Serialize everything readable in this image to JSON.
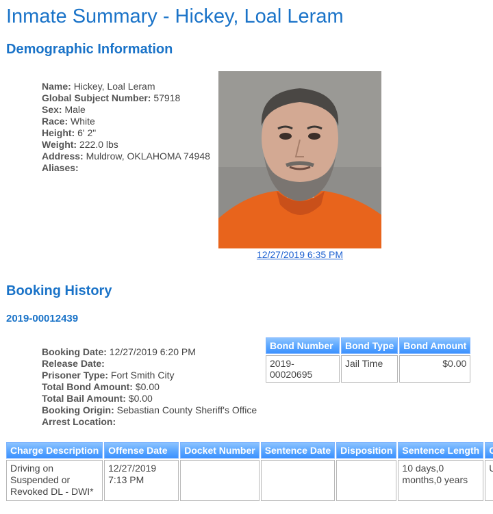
{
  "page": {
    "title": "Inmate Summary - Hickey, Loal Leram"
  },
  "demographic": {
    "heading": "Demographic Information",
    "fields": [
      {
        "label": "Name:",
        "value": "Hickey, Loal Leram"
      },
      {
        "label": "Global Subject Number:",
        "value": "57918"
      },
      {
        "label": "Sex:",
        "value": "Male"
      },
      {
        "label": "Race:",
        "value": "White"
      },
      {
        "label": "Height:",
        "value": "6' 2\""
      },
      {
        "label": "Weight:",
        "value": "222.0 lbs"
      },
      {
        "label": "Address:",
        "value": "Muldrow, OKLAHOMA 74948"
      },
      {
        "label": "Aliases:",
        "value": ""
      }
    ],
    "photo_date": "12/27/2019 6:35 PM"
  },
  "booking": {
    "heading": "Booking History",
    "number": "2019-00012439",
    "fields": [
      {
        "label": "Booking Date:",
        "value": "12/27/2019 6:20 PM"
      },
      {
        "label": "Release Date:",
        "value": ""
      },
      {
        "label": "Prisoner Type:",
        "value": "Fort Smith City"
      },
      {
        "label": "Total Bond Amount:",
        "value": "$0.00"
      },
      {
        "label": "Total Bail Amount:",
        "value": "$0.00"
      },
      {
        "label": "Booking Origin:",
        "value": "Sebastian County Sheriff's Office"
      },
      {
        "label": "Arrest Location:",
        "value": ""
      }
    ],
    "bond_table": {
      "headers": [
        "Bond Number",
        "Bond Type",
        "Bond Amount"
      ],
      "rows": [
        [
          "2019-00020695",
          "Jail Time",
          "$0.00"
        ]
      ]
    },
    "charge_table": {
      "headers": [
        "Charge Description",
        "Offense Date",
        "Docket Number",
        "Sentence Date",
        "Disposition",
        "Sentence Length",
        "C"
      ],
      "rows": [
        [
          "Driving on Suspended or Revoked DL - DWI*",
          "12/27/2019 7:13 PM",
          "",
          "",
          "",
          "10 days,0 months,0 years",
          "U"
        ]
      ]
    }
  },
  "colors": {
    "heading": "#1a73c8",
    "link": "#1a5fd1",
    "table_header": "#5aa6ff",
    "inmate_shirt": "#e8641c"
  },
  "icons": {
    "photo": "mugshot-photo"
  }
}
